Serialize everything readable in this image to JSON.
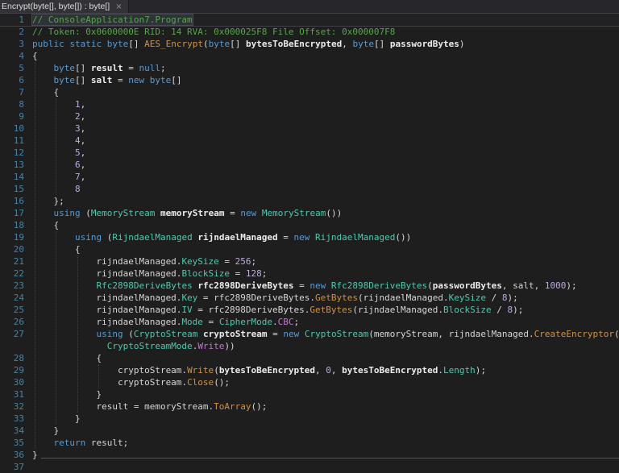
{
  "colors": {
    "background": "#1E1E1E",
    "text": "#D6D6D6",
    "keyword": "#569CD6",
    "comment": "#57A64A",
    "type": "#4EC9B0",
    "method": "#D1913F",
    "enum_member": "#B87BC7",
    "number": "#BFABDF",
    "line_number": "#4A81A4"
  },
  "tab": {
    "title": "Encrypt(byte[], byte[]) : byte[]",
    "close_glyph": "×"
  },
  "editor": {
    "lines": [
      {
        "no": 1,
        "highlight": true,
        "tokens": [
          [
            "c",
            "// ConsoleApplication7.Program"
          ]
        ]
      },
      {
        "no": 2,
        "tokens": [
          [
            "c",
            "// Token: 0x0600000E RID: 14 RVA: 0x000025F8 File Offset: 0x000007F8"
          ]
        ]
      },
      {
        "no": 3,
        "tokens": [
          [
            "k",
            "public"
          ],
          [
            "d",
            " "
          ],
          [
            "k",
            "static"
          ],
          [
            "d",
            " "
          ],
          [
            "k",
            "byte"
          ],
          [
            "d",
            "[] "
          ],
          [
            "m",
            "AES_Encrypt"
          ],
          [
            "d",
            "("
          ],
          [
            "k",
            "byte"
          ],
          [
            "d",
            "[] "
          ],
          [
            "pa",
            "bytesToBeEncrypted"
          ],
          [
            "d",
            ", "
          ],
          [
            "k",
            "byte"
          ],
          [
            "d",
            "[] "
          ],
          [
            "pa",
            "passwordBytes"
          ],
          [
            "d",
            ")"
          ]
        ]
      },
      {
        "no": 4,
        "tokens": [
          [
            "d",
            "{"
          ]
        ]
      },
      {
        "no": 5,
        "tokens": [
          [
            "d",
            "    "
          ],
          [
            "k",
            "byte"
          ],
          [
            "d",
            "[] "
          ],
          [
            "ld",
            "result"
          ],
          [
            "d",
            " = "
          ],
          [
            "k",
            "null"
          ],
          [
            "d",
            ";"
          ]
        ]
      },
      {
        "no": 6,
        "tokens": [
          [
            "d",
            "    "
          ],
          [
            "k",
            "byte"
          ],
          [
            "d",
            "[] "
          ],
          [
            "ld",
            "salt"
          ],
          [
            "d",
            " = "
          ],
          [
            "k",
            "new"
          ],
          [
            "d",
            " "
          ],
          [
            "k",
            "byte"
          ],
          [
            "d",
            "[]"
          ]
        ]
      },
      {
        "no": 7,
        "tokens": [
          [
            "d",
            "    {"
          ]
        ]
      },
      {
        "no": 8,
        "tokens": [
          [
            "d",
            "        "
          ],
          [
            "n",
            "1"
          ],
          [
            "d",
            ","
          ]
        ]
      },
      {
        "no": 9,
        "tokens": [
          [
            "d",
            "        "
          ],
          [
            "n",
            "2"
          ],
          [
            "d",
            ","
          ]
        ]
      },
      {
        "no": 10,
        "tokens": [
          [
            "d",
            "        "
          ],
          [
            "n",
            "3"
          ],
          [
            "d",
            ","
          ]
        ]
      },
      {
        "no": 11,
        "tokens": [
          [
            "d",
            "        "
          ],
          [
            "n",
            "4"
          ],
          [
            "d",
            ","
          ]
        ]
      },
      {
        "no": 12,
        "tokens": [
          [
            "d",
            "        "
          ],
          [
            "n",
            "5"
          ],
          [
            "d",
            ","
          ]
        ]
      },
      {
        "no": 13,
        "tokens": [
          [
            "d",
            "        "
          ],
          [
            "n",
            "6"
          ],
          [
            "d",
            ","
          ]
        ]
      },
      {
        "no": 14,
        "tokens": [
          [
            "d",
            "        "
          ],
          [
            "n",
            "7"
          ],
          [
            "d",
            ","
          ]
        ]
      },
      {
        "no": 15,
        "tokens": [
          [
            "d",
            "        "
          ],
          [
            "n",
            "8"
          ]
        ]
      },
      {
        "no": 16,
        "tokens": [
          [
            "d",
            "    };"
          ]
        ]
      },
      {
        "no": 17,
        "tokens": [
          [
            "d",
            "    "
          ],
          [
            "k",
            "using"
          ],
          [
            "d",
            " ("
          ],
          [
            "t",
            "MemoryStream"
          ],
          [
            "d",
            " "
          ],
          [
            "ld",
            "memoryStream"
          ],
          [
            "d",
            " = "
          ],
          [
            "k",
            "new"
          ],
          [
            "d",
            " "
          ],
          [
            "t",
            "MemoryStream"
          ],
          [
            "d",
            "())"
          ]
        ]
      },
      {
        "no": 18,
        "tokens": [
          [
            "d",
            "    {"
          ]
        ]
      },
      {
        "no": 19,
        "tokens": [
          [
            "d",
            "        "
          ],
          [
            "k",
            "using"
          ],
          [
            "d",
            " ("
          ],
          [
            "t",
            "RijndaelManaged"
          ],
          [
            "d",
            " "
          ],
          [
            "ld",
            "rijndaelManaged"
          ],
          [
            "d",
            " = "
          ],
          [
            "k",
            "new"
          ],
          [
            "d",
            " "
          ],
          [
            "t",
            "RijndaelManaged"
          ],
          [
            "d",
            "())"
          ]
        ]
      },
      {
        "no": 20,
        "tokens": [
          [
            "d",
            "        {"
          ]
        ]
      },
      {
        "no": 21,
        "tokens": [
          [
            "d",
            "            rijndaelManaged."
          ],
          [
            "t",
            "KeySize"
          ],
          [
            "d",
            " = "
          ],
          [
            "n",
            "256"
          ],
          [
            "d",
            ";"
          ]
        ]
      },
      {
        "no": 22,
        "tokens": [
          [
            "d",
            "            rijndaelManaged."
          ],
          [
            "t",
            "BlockSize"
          ],
          [
            "d",
            " = "
          ],
          [
            "n",
            "128"
          ],
          [
            "d",
            ";"
          ]
        ]
      },
      {
        "no": 23,
        "tokens": [
          [
            "d",
            "            "
          ],
          [
            "t",
            "Rfc2898DeriveBytes"
          ],
          [
            "d",
            " "
          ],
          [
            "ld",
            "rfc2898DeriveBytes"
          ],
          [
            "d",
            " = "
          ],
          [
            "k",
            "new"
          ],
          [
            "d",
            " "
          ],
          [
            "t",
            "Rfc2898DeriveBytes"
          ],
          [
            "d",
            "("
          ],
          [
            "pa",
            "passwordBytes"
          ],
          [
            "d",
            ", salt, "
          ],
          [
            "n",
            "1000"
          ],
          [
            "d",
            ");"
          ]
        ]
      },
      {
        "no": 24,
        "tokens": [
          [
            "d",
            "            rijndaelManaged."
          ],
          [
            "t",
            "Key"
          ],
          [
            "d",
            " = rfc2898DeriveBytes."
          ],
          [
            "m",
            "GetBytes"
          ],
          [
            "d",
            "(rijndaelManaged."
          ],
          [
            "t",
            "KeySize"
          ],
          [
            "d",
            " / "
          ],
          [
            "n",
            "8"
          ],
          [
            "d",
            ");"
          ]
        ]
      },
      {
        "no": 25,
        "tokens": [
          [
            "d",
            "            rijndaelManaged."
          ],
          [
            "t",
            "IV"
          ],
          [
            "d",
            " = rfc2898DeriveBytes."
          ],
          [
            "m",
            "GetBytes"
          ],
          [
            "d",
            "(rijndaelManaged."
          ],
          [
            "t",
            "BlockSize"
          ],
          [
            "d",
            " / "
          ],
          [
            "n",
            "8"
          ],
          [
            "d",
            ");"
          ]
        ]
      },
      {
        "no": 26,
        "tokens": [
          [
            "d",
            "            rijndaelManaged."
          ],
          [
            "t",
            "Mode"
          ],
          [
            "d",
            " = "
          ],
          [
            "t",
            "CipherMode"
          ],
          [
            "d",
            "."
          ],
          [
            "e",
            "CBC"
          ],
          [
            "d",
            ";"
          ]
        ]
      },
      {
        "no": 27,
        "tokens": [
          [
            "d",
            "            "
          ],
          [
            "k",
            "using"
          ],
          [
            "d",
            " ("
          ],
          [
            "t",
            "CryptoStream"
          ],
          [
            "d",
            " "
          ],
          [
            "ld",
            "cryptoStream"
          ],
          [
            "d",
            " = "
          ],
          [
            "k",
            "new"
          ],
          [
            "d",
            " "
          ],
          [
            "t",
            "CryptoStream"
          ],
          [
            "d",
            "(memoryStream, rijndaelManaged."
          ],
          [
            "m",
            "CreateEncryptor"
          ],
          [
            "d",
            "("
          ]
        ]
      },
      {
        "no": null,
        "tokens": [
          [
            "d",
            "              "
          ],
          [
            "t",
            "CryptoStreamMode"
          ],
          [
            "d",
            "."
          ],
          [
            "e",
            "Write"
          ],
          [
            "d",
            "))"
          ]
        ]
      },
      {
        "no": 28,
        "tokens": [
          [
            "d",
            "            {"
          ]
        ]
      },
      {
        "no": 29,
        "tokens": [
          [
            "d",
            "                cryptoStream."
          ],
          [
            "m",
            "Write"
          ],
          [
            "d",
            "("
          ],
          [
            "pa",
            "bytesToBeEncrypted"
          ],
          [
            "d",
            ", "
          ],
          [
            "n",
            "0"
          ],
          [
            "d",
            ", "
          ],
          [
            "pa",
            "bytesToBeEncrypted"
          ],
          [
            "d",
            "."
          ],
          [
            "t",
            "Length"
          ],
          [
            "d",
            ");"
          ]
        ]
      },
      {
        "no": 30,
        "tokens": [
          [
            "d",
            "                cryptoStream."
          ],
          [
            "m",
            "Close"
          ],
          [
            "d",
            "();"
          ]
        ]
      },
      {
        "no": 31,
        "tokens": [
          [
            "d",
            "            }"
          ]
        ]
      },
      {
        "no": 32,
        "tokens": [
          [
            "d",
            "            result = memoryStream."
          ],
          [
            "m",
            "ToArray"
          ],
          [
            "d",
            "();"
          ]
        ]
      },
      {
        "no": 33,
        "tokens": [
          [
            "d",
            "        }"
          ]
        ]
      },
      {
        "no": 34,
        "tokens": [
          [
            "d",
            "    }"
          ]
        ]
      },
      {
        "no": 35,
        "tokens": [
          [
            "d",
            "    "
          ],
          [
            "k",
            "return"
          ],
          [
            "d",
            " result;"
          ]
        ]
      },
      {
        "no": 36,
        "rule": true,
        "tokens": [
          [
            "d",
            "}"
          ]
        ]
      },
      {
        "no": 37,
        "tokens": []
      }
    ]
  }
}
